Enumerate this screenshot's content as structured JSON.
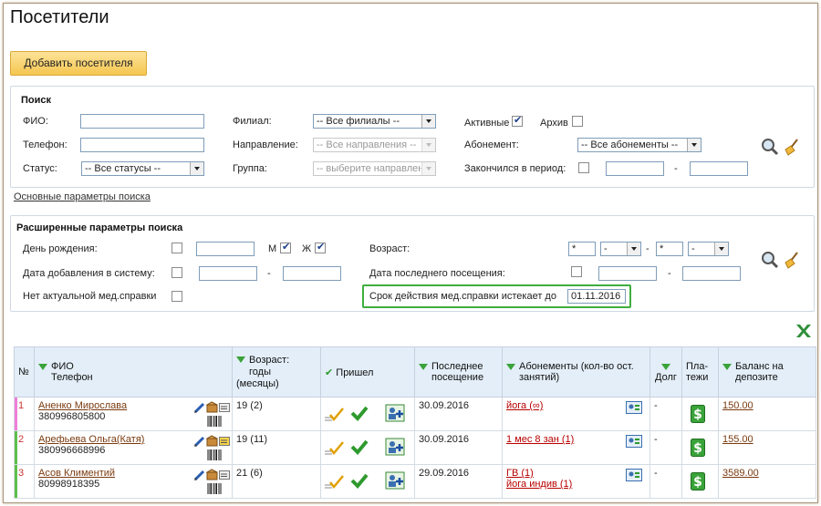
{
  "page": {
    "title": "Посетители",
    "add_button": "Добавить посетителя"
  },
  "search": {
    "title": "Поиск",
    "fio_label": "ФИО:",
    "phone_label": "Телефон:",
    "status_label": "Статус:",
    "status_value": "-- Все статусы --",
    "branch_label": "Филиал:",
    "branch_value": "-- Все филиалы --",
    "direction_label": "Направление:",
    "direction_value": "-- Все направления --",
    "group_label": "Группа:",
    "group_value": "-- выберите направление --",
    "active_label": "Активные",
    "archive_label": "Архив",
    "subscription_label": "Абонемент:",
    "subscription_value": "-- Все абонементы --",
    "ended_label": "Закончился в период:",
    "dash": "-",
    "basic_link": "Основные параметры поиска"
  },
  "extended": {
    "title": "Расширенные параметры поиска",
    "birthday_label": "День рождения:",
    "m_label": "М",
    "f_label": "Ж",
    "added_label": "Дата добавления в систему:",
    "no_med_label": "Нет актуальной мед.справки",
    "age_label": "Возраст:",
    "age_from": "*",
    "age_from_unit": "-",
    "age_to": "*",
    "age_to_unit": "-",
    "last_visit_label": "Дата последнего посещения:",
    "med_expire_label": "Срок действия мед.справки истекает до",
    "med_expire_value": "01.11.2016",
    "dash": "-"
  },
  "table": {
    "headers": {
      "num": "№",
      "fio": "ФИО",
      "phone": "Телефон",
      "age1": "Возраст:",
      "age2": "годы",
      "age3": "(месяцы)",
      "came": "Пришел",
      "last1": "Последнее",
      "last2": "посещение",
      "subs1": "Абонементы (кол-во ост.",
      "subs2": "занятий)",
      "debt": "Долг",
      "pay1": "Пла-",
      "pay2": "тежи",
      "bal1": "Баланс на",
      "bal2": "депозите"
    },
    "rows": [
      {
        "num": "1",
        "name": "Аненко Мирослава",
        "phone": "380996805800",
        "age": "19 (2)",
        "last": "30.09.2016",
        "subs": [
          "йога (∞)"
        ],
        "debt": "-",
        "balance": "150.00",
        "bar": "#ee7fd8"
      },
      {
        "num": "2",
        "name": "Арефьева Ольга(Катя)",
        "phone": "380996668996",
        "age": "19 (11)",
        "last": "30.09.2016",
        "subs": [
          "1 мес 8 зан (1)"
        ],
        "debt": "-",
        "balance": "155.00",
        "bar": "#5fbf4a"
      },
      {
        "num": "3",
        "name": "Асов Климентий",
        "phone": "80998918395",
        "age": "21 (6)",
        "last": "29.09.2016",
        "subs": [
          "ГВ (1)",
          "йога индив (1)"
        ],
        "debt": "-",
        "balance": "3589.00",
        "bar": "#5fbf4a"
      }
    ]
  }
}
